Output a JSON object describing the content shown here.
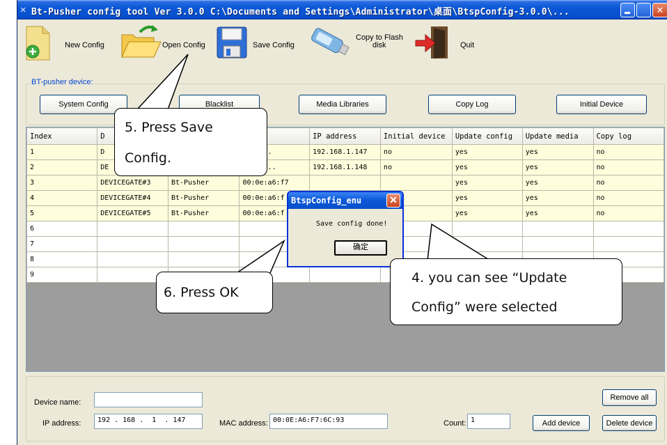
{
  "window": {
    "title": "Bt-Pusher config tool Ver 3.0.0    C:\\Documents and Settings\\Administrator\\桌面\\BtspConfig-3.0.0\\..."
  },
  "toolbar": {
    "new_config": "New Config",
    "open_config": "Open Config",
    "save_config": "Save Config",
    "copy_flash_line1": "Copy to Flash",
    "copy_flash_line2": "disk",
    "quit": "Quit"
  },
  "device_group": {
    "label": "BT-pusher device:",
    "buttons": {
      "system_config": "System Config",
      "blacklist": "Blacklist",
      "media_libraries": "Media Libraries",
      "copy_log": "Copy Log",
      "initial_device": "Initial Device"
    }
  },
  "table": {
    "columns": [
      "Index",
      "D",
      "",
      "ress",
      "IP address",
      "Initial device",
      "Update config",
      "Update media",
      "Copy log"
    ],
    "rows": [
      [
        "1",
        "D",
        "",
        "6:F7...",
        "192.168.1.147",
        "no",
        "yes",
        "yes",
        "no"
      ],
      [
        "2",
        "DE",
        "",
        "a6:f7...",
        "192.168.1.148",
        "no",
        "yes",
        "yes",
        "no"
      ],
      [
        "3",
        "DEVICEGATE#3",
        "Bt-Pusher",
        "00:0e:a6:f7",
        "",
        "",
        "yes",
        "yes",
        "no"
      ],
      [
        "4",
        "DEVICEGATE#4",
        "Bt-Pusher",
        "00:0e:a6:f",
        "",
        "",
        "yes",
        "yes",
        "no"
      ],
      [
        "5",
        "DEVICEGATE#5",
        "Bt-Pusher",
        "00:0e:a6:f",
        "",
        "",
        "yes",
        "yes",
        "no"
      ],
      [
        "6",
        "",
        "",
        "",
        "",
        "",
        "",
        "",
        ""
      ],
      [
        "7",
        "",
        "",
        "",
        "",
        "",
        "",
        "",
        ""
      ],
      [
        "8",
        "",
        "",
        "",
        "",
        "",
        "",
        "",
        ""
      ],
      [
        "9",
        "",
        "",
        "",
        "",
        "",
        "",
        "",
        ""
      ]
    ]
  },
  "form": {
    "device_name_label": "Device name:",
    "device_name_value": "",
    "ip_label": "IP address:",
    "ip_value": "192 . 168 .  1  . 147",
    "mac_label": "MAC address:",
    "mac_value": "00:0E:A6:F7:6C:93",
    "count_label": "Count:",
    "count_value": "1",
    "remove_all": "Remove all",
    "add_device": "Add device",
    "delete_device": "Delete device"
  },
  "dialog": {
    "title": "BtspConfig_enu",
    "message": "Save config done!",
    "ok": "确定"
  },
  "callouts": {
    "c5_line1": "5.  Press  Save",
    "c5_line2": "Config.",
    "c6": "6. Press OK",
    "c4_line1": "4. you can see “Update",
    "c4_line2": "Config” were selected"
  },
  "colors": {
    "title_blue": "#0a57d6",
    "face": "#ECE9D8",
    "row_highlight": "#fefedc",
    "group_label": "#0046d5"
  }
}
